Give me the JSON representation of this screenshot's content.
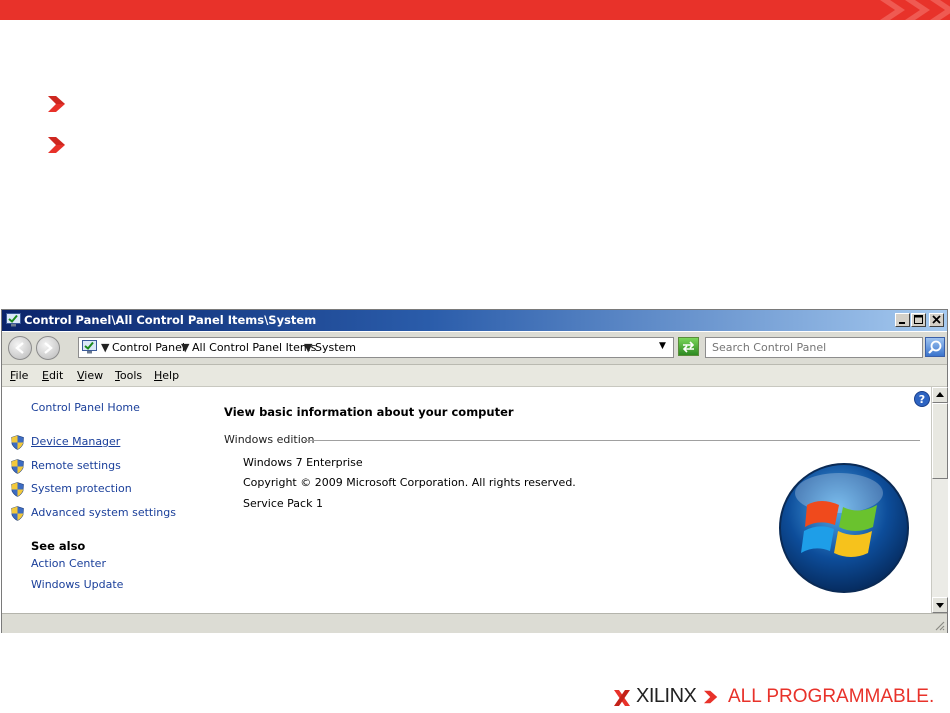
{
  "slide": {
    "footer": {
      "brand": "XILINX",
      "tagline": "ALL PROGRAMMABLE."
    },
    "colors": {
      "accent": "#e8322a"
    },
    "bullets": [
      "chevron-bullet-icon",
      "chevron-bullet-icon"
    ]
  },
  "window": {
    "title": "Control Panel\\All Control Panel Items\\System",
    "address": {
      "crumbs": [
        "Control Panel",
        "All Control Panel Items",
        "System"
      ]
    },
    "search": {
      "placeholder": "Search Control Panel"
    },
    "menu": [
      {
        "key": "F",
        "rest": "ile"
      },
      {
        "key": "E",
        "rest": "dit"
      },
      {
        "key": "V",
        "rest": "iew"
      },
      {
        "key": "T",
        "rest": "ools"
      },
      {
        "key": "H",
        "rest": "elp"
      }
    ],
    "sidebar": {
      "home": "Control Panel Home",
      "tasks": [
        "Device Manager",
        "Remote settings",
        "System protection",
        "Advanced system settings"
      ],
      "see_also_title": "See also",
      "see_also": [
        "Action Center",
        "Windows Update"
      ]
    },
    "main": {
      "heading": "View basic information about your computer",
      "section": "Windows edition",
      "edition": "Windows 7 Enterprise",
      "copyright": "Copyright © 2009 Microsoft Corporation.  All rights reserved.",
      "service_pack": "Service Pack 1"
    }
  }
}
